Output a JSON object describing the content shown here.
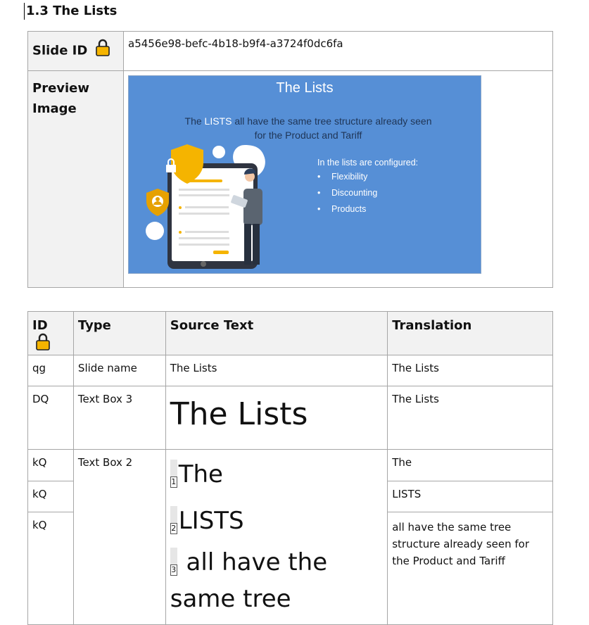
{
  "heading": "1.3 The Lists",
  "meta": {
    "slide_id_label": "Slide ID",
    "slide_id_value": "a5456e98-befc-4b18-b9f4-a3724f0dc6fa",
    "preview_label_1": "Preview",
    "preview_label_2": "Image",
    "slide": {
      "title": "The Lists",
      "subtitle_pre": "The ",
      "subtitle_hl": "LISTS",
      "subtitle_post": " all have the same tree structure already seen for the Product and Tariff",
      "list_heading": "In the lists are configured:",
      "bullets": [
        "Flexibility",
        "Discounting",
        "Products"
      ]
    }
  },
  "table": {
    "headers": {
      "id": "ID",
      "type": "Type",
      "source": "Source Text",
      "translation": "Translation"
    },
    "rows": [
      {
        "id": "qg",
        "type": "Slide name",
        "source": "The Lists",
        "translation": "The Lists"
      },
      {
        "id": "DQ",
        "type": "Text Box 3",
        "source": "The Lists",
        "translation": "The Lists"
      },
      {
        "id": "kQ",
        "type": "Text Box 2",
        "translation": "The"
      },
      {
        "id": "kQ",
        "translation": "LISTS"
      },
      {
        "id": "kQ",
        "translation": " all have the same tree structure already seen for the Product and Tariff"
      }
    ],
    "source_segments": [
      {
        "tag": "1",
        "text": "The"
      },
      {
        "tag": "2",
        "text": "LISTS"
      },
      {
        "tag": "3",
        "text": " all have the same tree"
      }
    ]
  }
}
